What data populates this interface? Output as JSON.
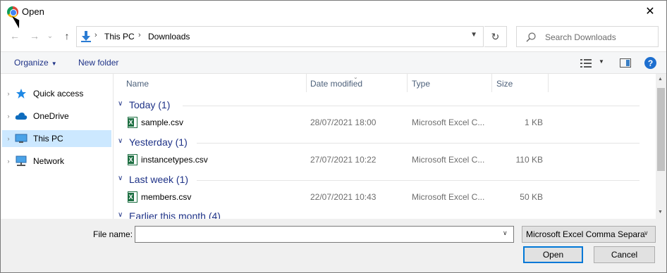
{
  "window": {
    "title": "Open",
    "close_glyph": "✕"
  },
  "nav": {
    "back_glyph": "←",
    "forward_glyph": "→",
    "recent_glyph": "⌄",
    "up_glyph": "↑",
    "breadcrumb": [
      "This PC",
      "Downloads"
    ],
    "breadcrumb_sep": "›",
    "refresh_glyph": "↻",
    "search_placeholder": "Search Downloads"
  },
  "toolbar": {
    "organize_label": "Organize",
    "new_folder_label": "New folder",
    "help_glyph": "?"
  },
  "sidebar": {
    "items": [
      {
        "label": "Quick access",
        "icon": "star-icon"
      },
      {
        "label": "OneDrive",
        "icon": "cloud-icon"
      },
      {
        "label": "This PC",
        "icon": "computer-icon",
        "selected": true
      },
      {
        "label": "Network",
        "icon": "network-icon"
      }
    ]
  },
  "columns": [
    "Name",
    "Date modified",
    "Type",
    "Size"
  ],
  "groups": [
    {
      "label": "Today (1)",
      "files": [
        {
          "name": "sample.csv",
          "date": "28/07/2021 18:00",
          "type": "Microsoft Excel C...",
          "size": "1 KB"
        }
      ]
    },
    {
      "label": "Yesterday (1)",
      "files": [
        {
          "name": "instancetypes.csv",
          "date": "27/07/2021 10:22",
          "type": "Microsoft Excel C...",
          "size": "110 KB"
        }
      ]
    },
    {
      "label": "Last week (1)",
      "files": [
        {
          "name": "members.csv",
          "date": "22/07/2021 10:43",
          "type": "Microsoft Excel C...",
          "size": "50 KB"
        }
      ]
    },
    {
      "label": "Earlier this month (4)",
      "files": []
    }
  ],
  "bottom": {
    "file_name_label": "File name:",
    "file_name_value": "",
    "filter_value": "Microsoft Excel Comma Separa",
    "open_label": "Open",
    "cancel_label": "Cancel"
  },
  "colors": {
    "accent": "#1e3287",
    "selection": "#cce8ff",
    "primary_border": "#0078d7"
  }
}
